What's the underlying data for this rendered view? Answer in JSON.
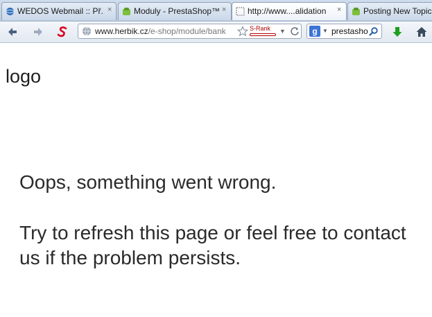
{
  "browser": {
    "tabs": [
      {
        "label": "WEDOS Webmail :: Př...",
        "close": "×"
      },
      {
        "label": "Moduly - PrestaShop™",
        "close": "×"
      },
      {
        "label": "http://www....alidation",
        "close": "×"
      },
      {
        "label": "Posting New Topic",
        "close": ""
      }
    ],
    "url": {
      "host": "www.herbik.cz",
      "path": "/e-shop/module/bank"
    },
    "srank_label": "S-Rank",
    "search": {
      "engine_letter": "g",
      "value": "prestasho"
    }
  },
  "page": {
    "logo_text": "logo",
    "error_title": "Oops, something went wrong.",
    "error_message": "Try to refresh this page or feel free to contact us if the problem persists."
  },
  "colors": {
    "accent_red": "#d8001e",
    "green_download": "#1ea01e"
  }
}
